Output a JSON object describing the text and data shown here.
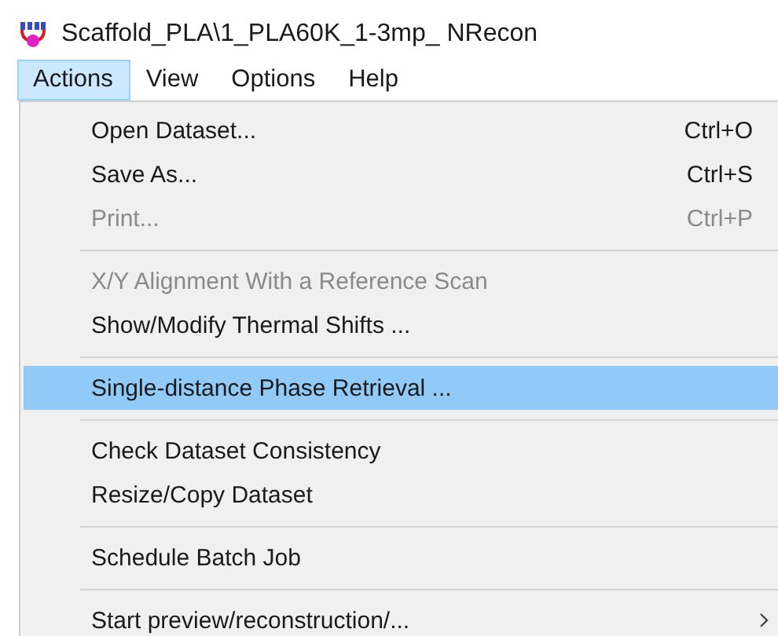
{
  "window": {
    "title": "Scaffold_PLA\\1_PLA60K_1-3mp_  NRecon"
  },
  "menubar": [
    {
      "label": "Actions",
      "selected": true
    },
    {
      "label": "View",
      "selected": false
    },
    {
      "label": "Options",
      "selected": false
    },
    {
      "label": "Help",
      "selected": false
    }
  ],
  "menu": [
    {
      "kind": "item",
      "label": "Open Dataset...",
      "shortcut": "Ctrl+O",
      "disabled": false,
      "selected": false,
      "submenu": false
    },
    {
      "kind": "item",
      "label": "Save As...",
      "shortcut": "Ctrl+S",
      "disabled": false,
      "selected": false,
      "submenu": false
    },
    {
      "kind": "item",
      "label": "Print...",
      "shortcut": "Ctrl+P",
      "disabled": true,
      "selected": false,
      "submenu": false
    },
    {
      "kind": "separator"
    },
    {
      "kind": "item",
      "label": "X/Y Alignment With a Reference Scan",
      "disabled": true,
      "selected": false,
      "submenu": false
    },
    {
      "kind": "item",
      "label": "Show/Modify Thermal Shifts ...",
      "disabled": false,
      "selected": false,
      "submenu": false
    },
    {
      "kind": "separator"
    },
    {
      "kind": "item",
      "label": "Single-distance Phase Retrieval ...",
      "disabled": false,
      "selected": true,
      "submenu": false
    },
    {
      "kind": "separator"
    },
    {
      "kind": "item",
      "label": "Check Dataset Consistency",
      "disabled": false,
      "selected": false,
      "submenu": false
    },
    {
      "kind": "item",
      "label": "Resize/Copy Dataset",
      "disabled": false,
      "selected": false,
      "submenu": false
    },
    {
      "kind": "separator"
    },
    {
      "kind": "item",
      "label": "Schedule Batch Job",
      "disabled": false,
      "selected": false,
      "submenu": false
    },
    {
      "kind": "separator"
    },
    {
      "kind": "item",
      "label": "Start preview/reconstruction/...",
      "disabled": false,
      "selected": false,
      "submenu": true
    }
  ]
}
